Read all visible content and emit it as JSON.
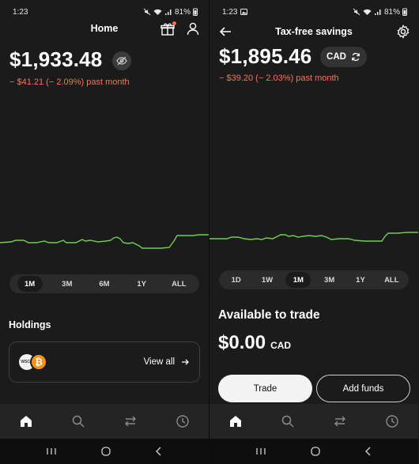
{
  "left": {
    "status": {
      "time": "1:23",
      "battery": "81%"
    },
    "title": "Home",
    "balance": "$1,933.48",
    "change": "− $41.21 (− 2.09%) past month",
    "ranges": [
      "1M",
      "3M",
      "6M",
      "1Y",
      "ALL"
    ],
    "active_range": "1M",
    "holdings": {
      "title": "Holdings",
      "view_all": "View all",
      "coin_a": "WSCN",
      "coin_b": "₿"
    }
  },
  "right": {
    "status": {
      "time": "1:23",
      "battery": "81%"
    },
    "title": "Tax-free savings",
    "balance": "$1,895.46",
    "currency": "CAD",
    "change": "− $39.20 (− 2.03%) past month",
    "ranges": [
      "1D",
      "1W",
      "1M",
      "3M",
      "1Y",
      "ALL"
    ],
    "active_range": "1M",
    "available": {
      "title": "Available to trade",
      "amount": "$0.00",
      "currency": "CAD"
    },
    "buttons": {
      "trade": "Trade",
      "add_funds": "Add funds"
    }
  },
  "colors": {
    "background": "#1b1b1b",
    "chart_line": "#6fcf54",
    "negative": "#f07657",
    "notification_dot": "#ff6b4a"
  },
  "tabs": [
    "home-icon",
    "search-icon",
    "transfer-icon",
    "activity-icon"
  ],
  "system_nav": [
    "recents-icon",
    "home-circle-icon",
    "back-icon"
  ]
}
